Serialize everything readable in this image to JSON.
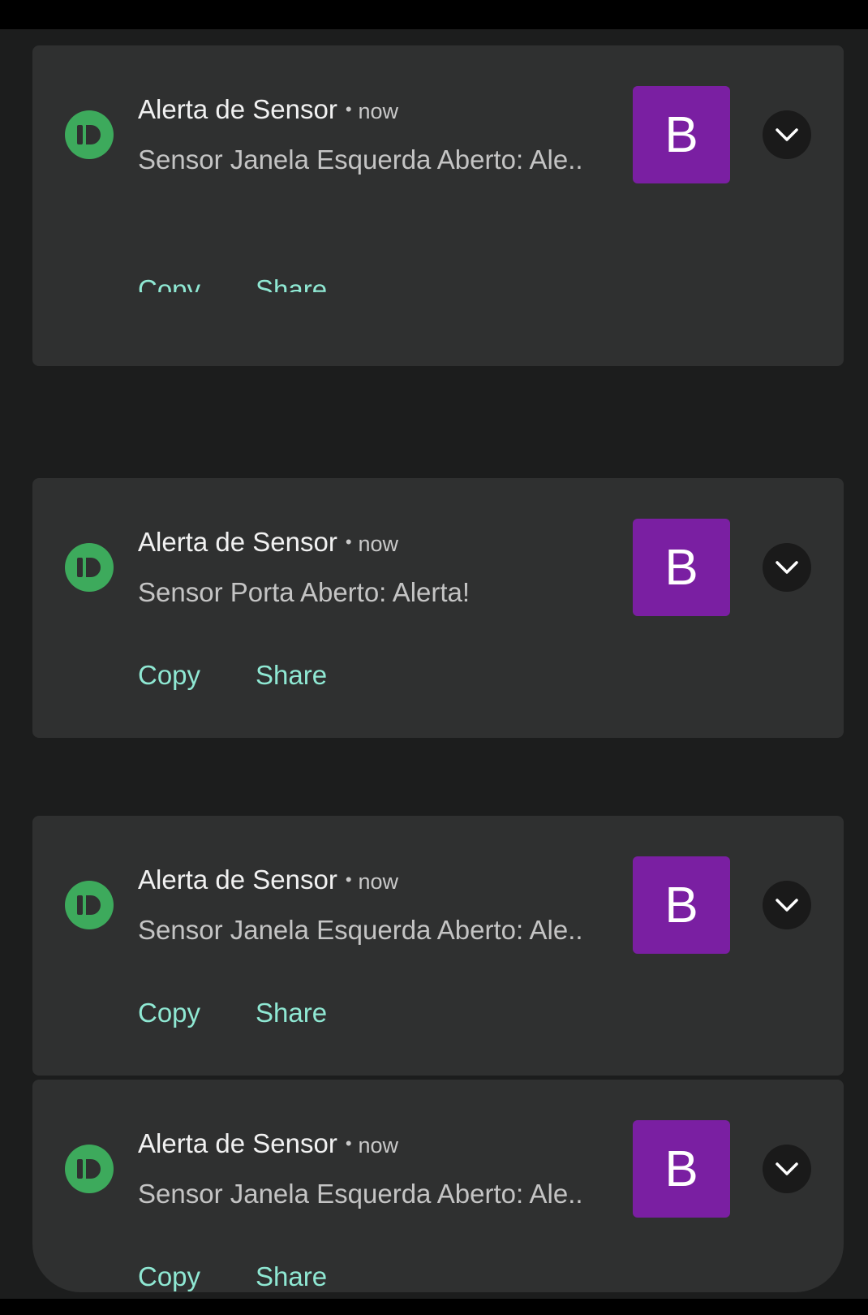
{
  "colors": {
    "background": "#1c1d1d",
    "card": "#2f3030",
    "app_icon": "#3daa5c",
    "avatar": "#7a1fa2",
    "action_text": "#8fe8d3"
  },
  "icons": {
    "app": "app-logo-icon",
    "expand": "chevron-down-icon"
  },
  "notifications": [
    {
      "title": "Alerta de Sensor",
      "separator": "•",
      "time": "now",
      "body": "Sensor Janela Esquerda Aberto: Ale..",
      "avatar_letter": "B",
      "actions": [
        "Copy",
        "Share"
      ]
    },
    {
      "title": "Alerta de Sensor",
      "separator": "•",
      "time": "now",
      "body": "Sensor Porta Aberto: Alerta!",
      "avatar_letter": "B",
      "actions": [
        "Copy",
        "Share"
      ]
    },
    {
      "title": "Alerta de Sensor",
      "separator": "•",
      "time": "now",
      "body": "Sensor Janela Esquerda Aberto: Ale..",
      "avatar_letter": "B",
      "actions": [
        "Copy",
        "Share"
      ]
    },
    {
      "title": "Alerta de Sensor",
      "separator": "•",
      "time": "now",
      "body": "Sensor Janela Esquerda Aberto: Ale..",
      "avatar_letter": "B",
      "actions": [
        "Copy",
        "Share"
      ]
    }
  ]
}
